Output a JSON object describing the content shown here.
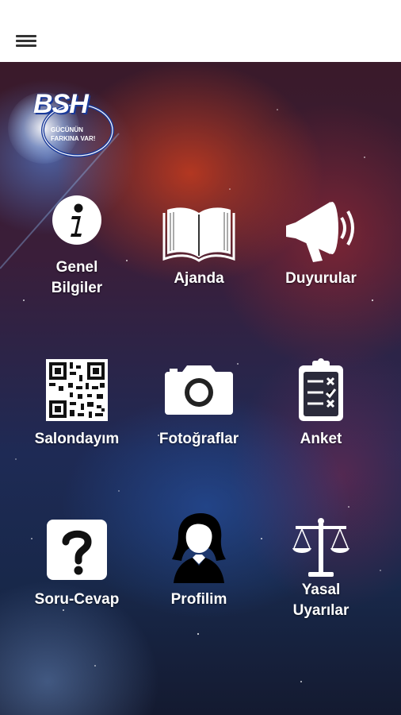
{
  "header": {
    "menu_icon": "hamburger-menu-icon"
  },
  "logo": {
    "brand": "BSH",
    "tagline_line1": "GÜCÜNÜN",
    "tagline_line2": "FARKINA VAR!"
  },
  "menu": [
    {
      "id": "genel-bilgiler",
      "label_line1": "Genel",
      "label_line2": "Bilgiler",
      "icon": "info-icon"
    },
    {
      "id": "ajanda",
      "label_line1": "Ajanda",
      "label_line2": "",
      "icon": "book-icon"
    },
    {
      "id": "duyurular",
      "label_line1": "Duyurular",
      "label_line2": "",
      "icon": "megaphone-icon"
    },
    {
      "id": "salondayim",
      "label_line1": "Salondayım",
      "label_line2": "",
      "icon": "qr-code-icon"
    },
    {
      "id": "fotograflar",
      "label_line1": "Fotoğraflar",
      "label_line2": "",
      "icon": "camera-icon"
    },
    {
      "id": "anket",
      "label_line1": "Anket",
      "label_line2": "",
      "icon": "clipboard-icon"
    },
    {
      "id": "soru-cevap",
      "label_line1": "Soru-Cevap",
      "label_line2": "",
      "icon": "question-icon"
    },
    {
      "id": "profilim",
      "label_line1": "Profilim",
      "label_line2": "",
      "icon": "profile-icon"
    },
    {
      "id": "yasal-uyarilar",
      "label_line1": "Yasal",
      "label_line2": "Uyarılar",
      "icon": "scales-icon"
    }
  ]
}
